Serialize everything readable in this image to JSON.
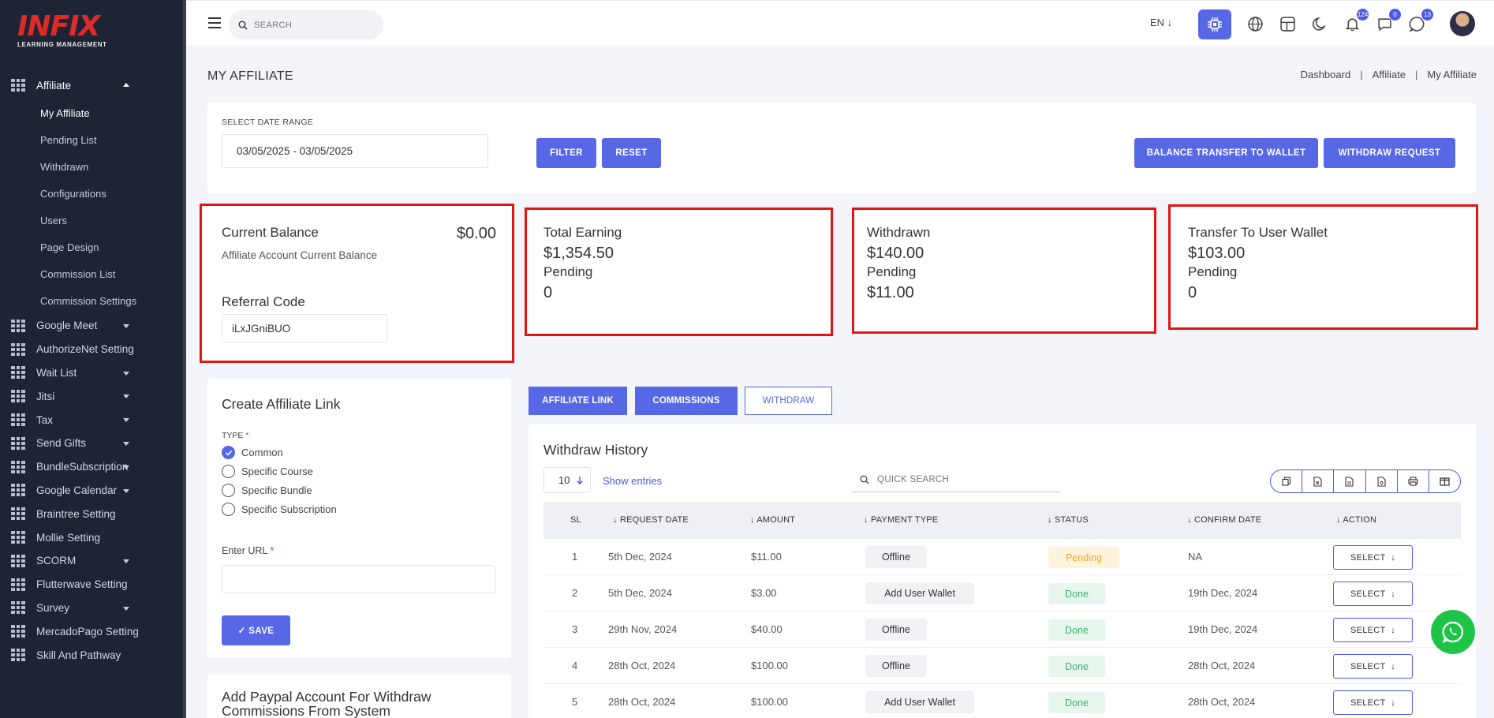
{
  "brand": {
    "logo": "INFIX",
    "subtitle": "LEARNING MANAGEMENT"
  },
  "sidebar": {
    "affiliate": {
      "label": "Affiliate",
      "icon": "grid-icon"
    },
    "sub_items": [
      "My Affiliate",
      "Pending List",
      "Withdrawn",
      "Configurations",
      "Users",
      "Page Design",
      "Commission List",
      "Commission Settings"
    ],
    "items": [
      {
        "label": "Google Meet",
        "has_caret": true
      },
      {
        "label": "AuthorizeNet Setting",
        "has_caret": false
      },
      {
        "label": "Wait List",
        "has_caret": true
      },
      {
        "label": "Jitsi",
        "has_caret": true
      },
      {
        "label": "Tax",
        "has_caret": true
      },
      {
        "label": "Send Gifts",
        "has_caret": true
      },
      {
        "label": "BundleSubscription",
        "has_caret": true
      },
      {
        "label": "Google Calendar",
        "has_caret": true
      },
      {
        "label": "Braintree Setting",
        "has_caret": false
      },
      {
        "label": "Mollie Setting",
        "has_caret": false
      },
      {
        "label": "SCORM",
        "has_caret": true
      },
      {
        "label": "Flutterwave Setting",
        "has_caret": false
      },
      {
        "label": "Survey",
        "has_caret": true
      },
      {
        "label": "MercadoPago Setting",
        "has_caret": false
      },
      {
        "label": "Skill And Pathway",
        "has_caret": false
      }
    ]
  },
  "topbar": {
    "search_placeholder": "SEARCH",
    "language": "EN ↓",
    "notifications_count": "124",
    "messages_count": "0",
    "chat_count": "13"
  },
  "page": {
    "title": "MY AFFILIATE",
    "breadcrumb": [
      "Dashboard",
      "Affiliate",
      "My Affiliate"
    ]
  },
  "filter": {
    "label": "SELECT DATE RANGE",
    "date_range": "03/05/2025 - 03/05/2025",
    "filter_btn": "FILTER",
    "reset_btn": "RESET",
    "balance_transfer_btn": "BALANCE TRANSFER TO WALLET",
    "withdraw_request_btn": "WITHDRAW REQUEST"
  },
  "stats": {
    "current_balance": {
      "title": "Current Balance",
      "value": "$0.00",
      "subtitle": "Affiliate Account Current Balance",
      "referral_label": "Referral Code",
      "referral_code": "iLxJGniBUO"
    },
    "total_earning": {
      "title": "Total Earning",
      "value": "$1,354.50",
      "pending_label": "Pending",
      "pending_value": "0"
    },
    "withdrawn": {
      "title": "Withdrawn",
      "value": "$140.00",
      "pending_label": "Pending",
      "pending_value": "$11.00"
    },
    "transfer": {
      "title": "Transfer To User Wallet",
      "value": "$103.00",
      "pending_label": "Pending",
      "pending_value": "0"
    }
  },
  "create_link": {
    "title": "Create Affiliate Link",
    "type_label": "TYPE",
    "options": [
      "Common",
      "Specific Course",
      "Specific Bundle",
      "Specific Subscription"
    ],
    "selected": 0,
    "url_label": "Enter URL",
    "url_value": "",
    "save_btn": "✓ SAVE"
  },
  "paypal": {
    "title": "Add Paypal Account For Withdraw Commissions From System"
  },
  "tabs": [
    "AFFILIATE LINK",
    "COMMISSIONS",
    "WITHDRAW"
  ],
  "history": {
    "title": "Withdraw History",
    "entries": "10",
    "entries_text": "Show entries",
    "search_placeholder": "QUICK SEARCH",
    "columns": [
      "SL",
      "REQUEST DATE",
      "AMOUNT",
      "PAYMENT TYPE",
      "STATUS",
      "CONFIRM DATE",
      "ACTION"
    ],
    "action_label": "SELECT",
    "rows": [
      {
        "sl": "1",
        "date": "5th Dec, 2024",
        "amount": "$11.00",
        "type": "Offline",
        "status": "Pending",
        "confirm": "NA"
      },
      {
        "sl": "2",
        "date": "5th Dec, 2024",
        "amount": "$3.00",
        "type": "Add User Wallet",
        "status": "Done",
        "confirm": "19th Dec, 2024"
      },
      {
        "sl": "3",
        "date": "29th Nov, 2024",
        "amount": "$40.00",
        "type": "Offline",
        "status": "Done",
        "confirm": "19th Dec, 2024"
      },
      {
        "sl": "4",
        "date": "28th Oct, 2024",
        "amount": "$100.00",
        "type": "Offline",
        "status": "Done",
        "confirm": "28th Oct, 2024"
      },
      {
        "sl": "5",
        "date": "28th Oct, 2024",
        "amount": "$100.00",
        "type": "Add User Wallet",
        "status": "Done",
        "confirm": "28th Oct, 2024"
      }
    ]
  },
  "colors": {
    "accent": "#5668e6",
    "sidebar": "#1f2434",
    "highlight_border": "#e41414",
    "whatsapp": "#1ec447"
  }
}
